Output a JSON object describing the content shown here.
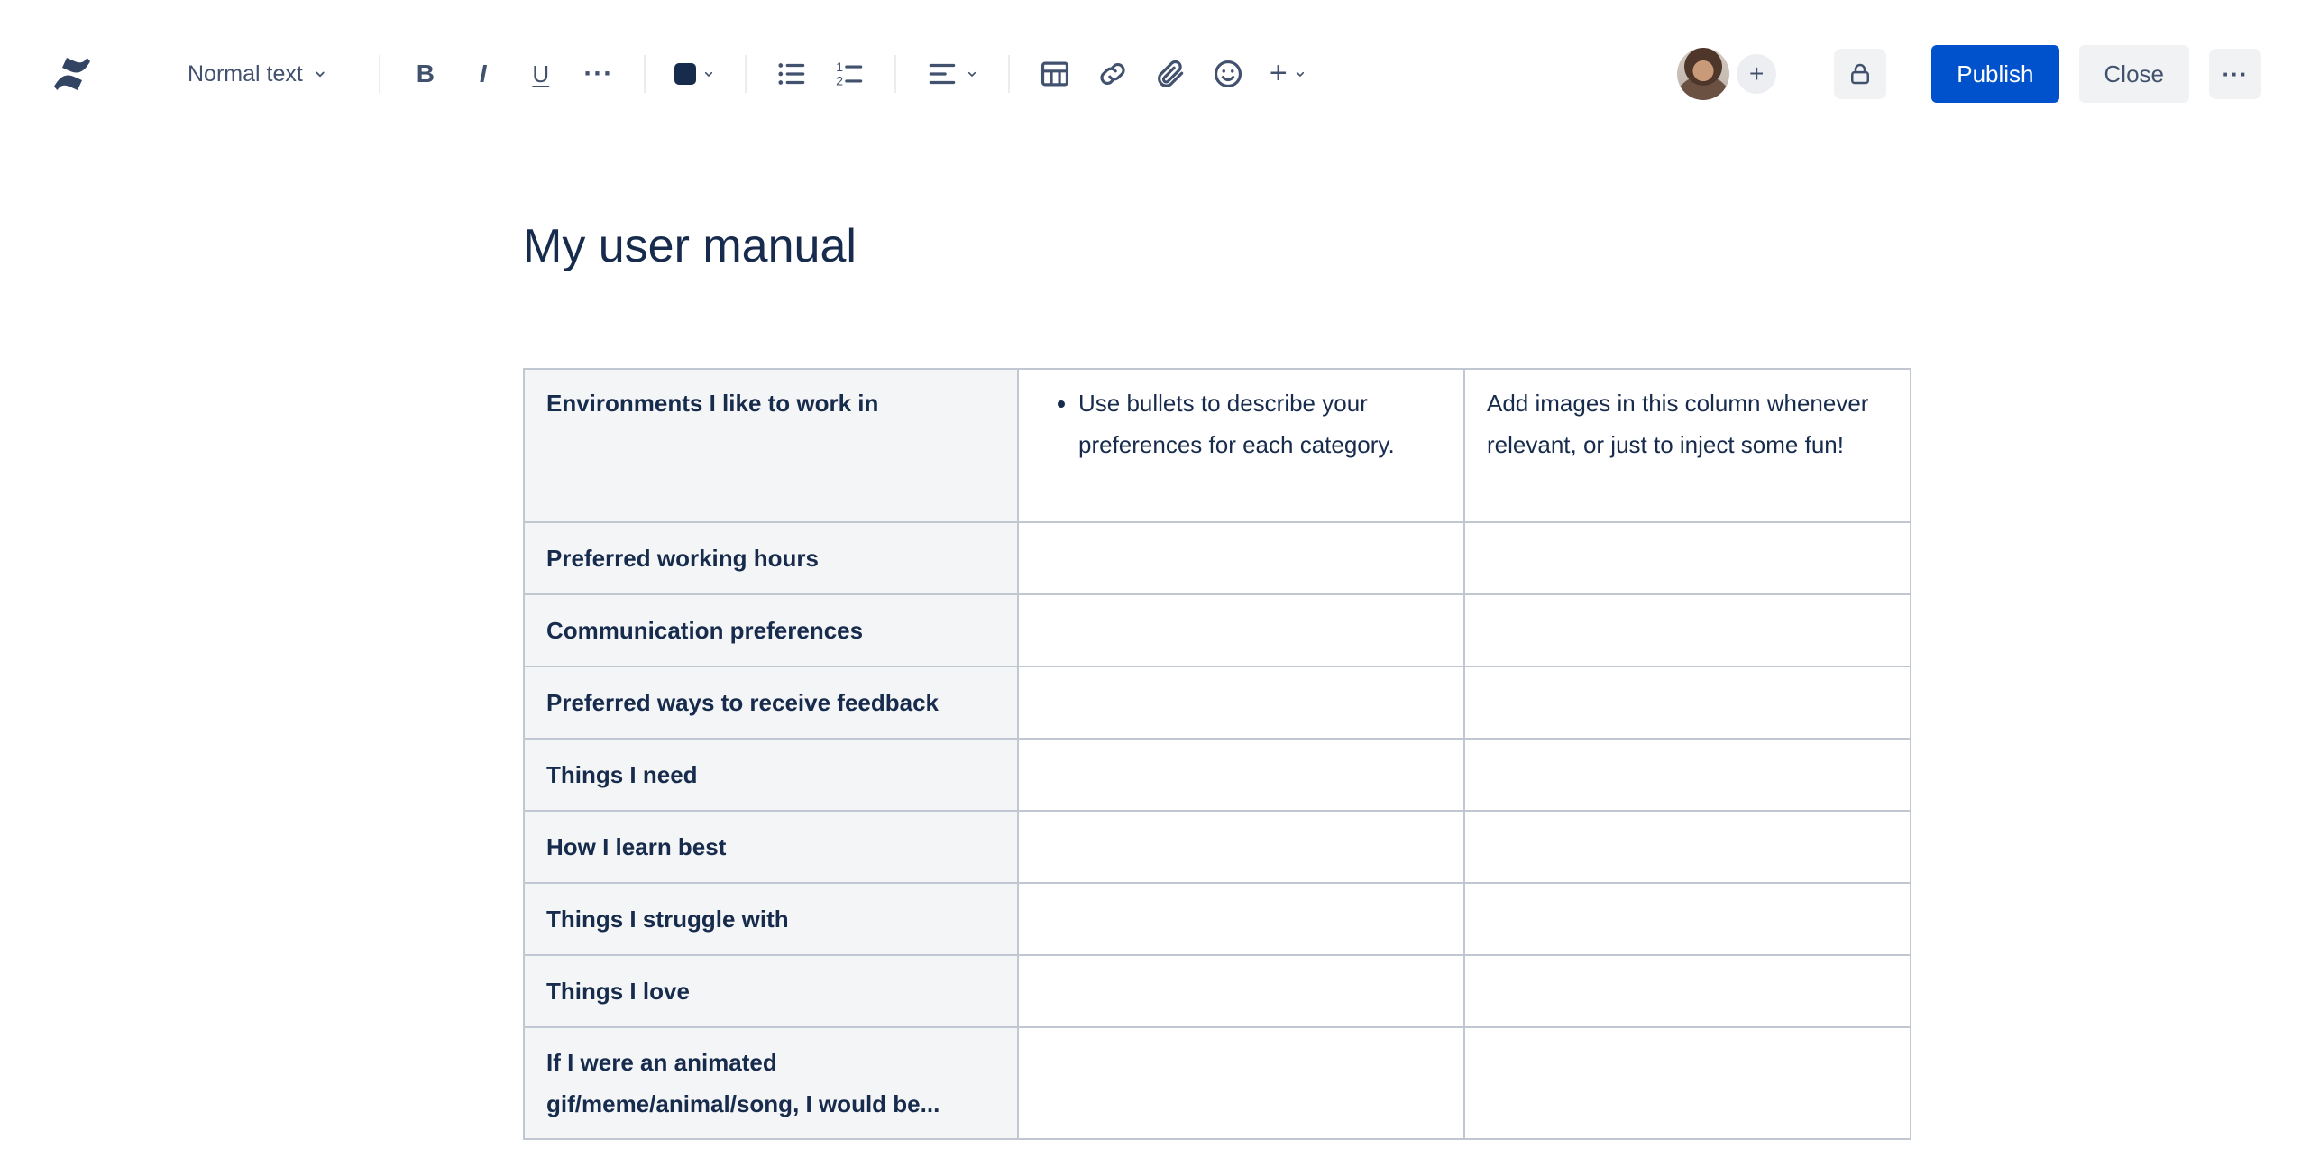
{
  "colors": {
    "publish_blue": "#0052CC",
    "toolbar_icon": "#42526E",
    "text_primary": "#172B4D",
    "table_border": "#C1C7D0",
    "label_cell_bg": "#F4F5F7",
    "neutral_button_bg": "#F1F2F4"
  },
  "toolbar": {
    "style_dropdown": {
      "label": "Normal text"
    },
    "bold_label": "B",
    "italic_label": "I",
    "underline_label": "U",
    "more_formatting_label": "···",
    "insert_plus_label": "+",
    "publish_label": "Publish",
    "close_label": "Close",
    "more_actions_label": "···",
    "add_collaborator_label": "+"
  },
  "document": {
    "title": "My user manual",
    "table": {
      "header": {
        "label": "Environments I like to work in",
        "bullet_item": "Use bullets to describe your preferences for each category.",
        "images_note": "Add images in this column whenever relevant, or just to inject some fun!"
      },
      "row_labels": [
        "Preferred working hours",
        "Communication preferences",
        "Preferred ways to receive feedback",
        "Things I need",
        "How I learn best",
        "Things I struggle with",
        "Things I love",
        "If I were an animated gif/meme/animal/song, I would be..."
      ]
    }
  }
}
